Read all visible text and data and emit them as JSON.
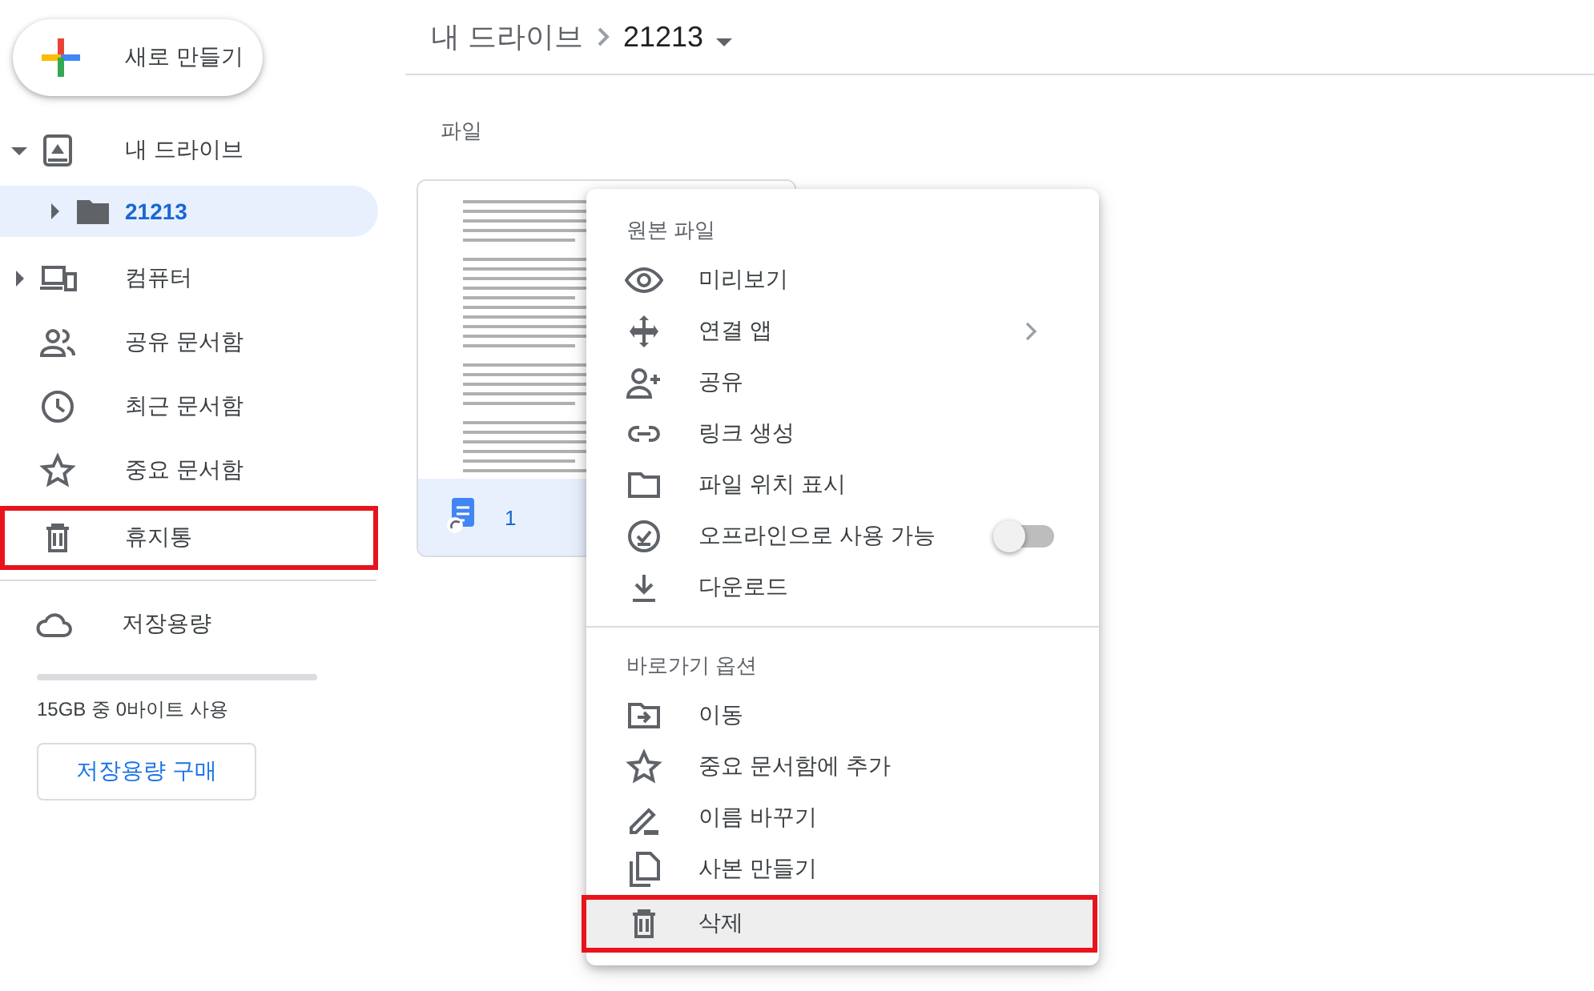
{
  "sidebar": {
    "new_button": "새로 만들기",
    "items": [
      {
        "kind": "tree",
        "label": "내 드라이브",
        "expanded": true,
        "selected": false,
        "highlighted": false,
        "children": [
          {
            "kind": "tree",
            "label": "21213",
            "expanded": false,
            "selected": true,
            "highlighted": false
          }
        ]
      },
      {
        "kind": "tree",
        "label": "컴퓨터",
        "expanded": false,
        "selected": false,
        "highlighted": false
      },
      {
        "kind": "link",
        "label": "공유 문서함",
        "selected": false,
        "highlighted": false
      },
      {
        "kind": "link",
        "label": "최근 문서함",
        "selected": false,
        "highlighted": false
      },
      {
        "kind": "link",
        "label": "중요 문서함",
        "selected": false,
        "highlighted": false
      },
      {
        "kind": "link",
        "label": "휴지통",
        "selected": false,
        "highlighted": true
      }
    ],
    "storage": {
      "label": "저장용량",
      "level": 0,
      "usage": "15GB 중 0바이트 사용",
      "buy_button": "저장용량 구매"
    }
  },
  "breadcrumb": [
    {
      "label": "내 드라이브"
    },
    {
      "label": "21213"
    }
  ],
  "section_title": "파일",
  "files": [
    {
      "kind": "picture",
      "name": "1",
      "selected": true
    }
  ],
  "context_menu": {
    "sections": [
      {
        "title": "원본 파일",
        "items": [
          {
            "kind": "action",
            "label": "미리보기",
            "highlighted": false
          },
          {
            "kind": "submenu",
            "label": "연결 앱",
            "highlighted": false
          },
          {
            "kind": "action",
            "label": "공유",
            "highlighted": false
          },
          {
            "kind": "action",
            "label": "링크 생성",
            "highlighted": false
          },
          {
            "kind": "action",
            "label": "파일 위치 표시",
            "highlighted": false
          },
          {
            "kind": "toggle",
            "label": "오프라인으로 사용 가능",
            "on": false,
            "highlighted": false
          },
          {
            "kind": "action",
            "label": "다운로드",
            "highlighted": false
          }
        ]
      },
      {
        "title": "바로가기 옵션",
        "items": [
          {
            "kind": "action",
            "label": "이동",
            "highlighted": false
          },
          {
            "kind": "action",
            "label": "중요 문서함에 추가",
            "highlighted": false
          },
          {
            "kind": "action",
            "label": "이름 바꾸기",
            "highlighted": false
          },
          {
            "kind": "action",
            "label": "사본 만들기",
            "highlighted": false
          },
          {
            "kind": "action",
            "label": "삭제",
            "highlighted": true
          }
        ]
      }
    ]
  }
}
